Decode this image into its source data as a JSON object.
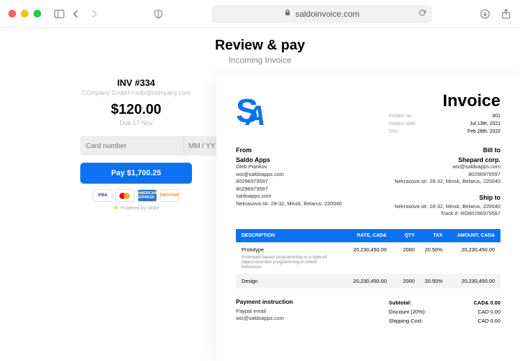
{
  "browser": {
    "url": "saldoinvoice.com"
  },
  "header": {
    "title": "Review & pay",
    "subtitle": "Incoming Invoice"
  },
  "pay": {
    "inv": "INV #334",
    "company": "COmpany GmbH • info@company.com",
    "amount": "$120.00",
    "due": "Due 17 Nov",
    "card_placeholder": "Card number",
    "exp_placeholder": "MM / YY",
    "button": "Pay $1,700.25",
    "visa": "VISA",
    "amex": "AMERICAN EXPRESS",
    "discover": "DISCOVER",
    "powered": "Powered by stripe"
  },
  "invoice": {
    "title": "Invoice",
    "meta": {
      "no_label": "Invoice no.:",
      "no_val": "001",
      "date_label": "Invoice date:",
      "date_val": "Jul 13th, 2021",
      "due_label": "Due:",
      "due_val": "Feb 28th, 2022"
    },
    "from_label": "From",
    "from": {
      "name": "Saldo Apps",
      "contact": "Gleb Piankov",
      "email": "wiz@saldoapps.com",
      "phone1": "80296979597",
      "phone2": "80296979597",
      "site": "saldoapps.com",
      "address": "Nekrasova str. 28-32, Minsk, Belarus, 220040"
    },
    "billto_label": "Bill to",
    "billto": {
      "name": "Shepard corp.",
      "email": "wiz@saldoapps.com",
      "phone": "80296979597",
      "address": "Nekrasova str. 28-32, Minsk, Belarus, 220040"
    },
    "shipto_label": "Ship to",
    "shipto": {
      "address": "Nekrasova str. 28-32, Minsk, Belarus, 220040",
      "track": "Track #: RO80296979597"
    },
    "th": {
      "desc": "DESCRIPTION",
      "rate": "RATE, CAD&",
      "qty": "QTY",
      "tax": "TAX",
      "amt": "AMOUNT, CAD&"
    },
    "rows": [
      {
        "desc": "Prototype",
        "note": "Prototype-based programming is a style of object-oriented programming in which behaviour",
        "rate": "20,230,450.00",
        "qty": "2000",
        "tax": "20.50%",
        "amt": "20,230,450.00"
      },
      {
        "desc": "Design",
        "note": "",
        "rate": "20,230,450.00",
        "qty": "2000",
        "tax": "20.50%",
        "amt": "20,230,450.00"
      }
    ],
    "footer": {
      "instr_label": "Payment instruction",
      "paypal_label": "Paypal email",
      "paypal": "wiz@saldoapps.com",
      "subtotal_label": "Subtotal:",
      "subtotal_val": "CAD& 0.00",
      "discount_label": "Discount (20%):",
      "discount_val": "CAD 0.00",
      "shipping_label": "Shipping Cost:",
      "shipping_val": "CAD 0.00"
    }
  }
}
